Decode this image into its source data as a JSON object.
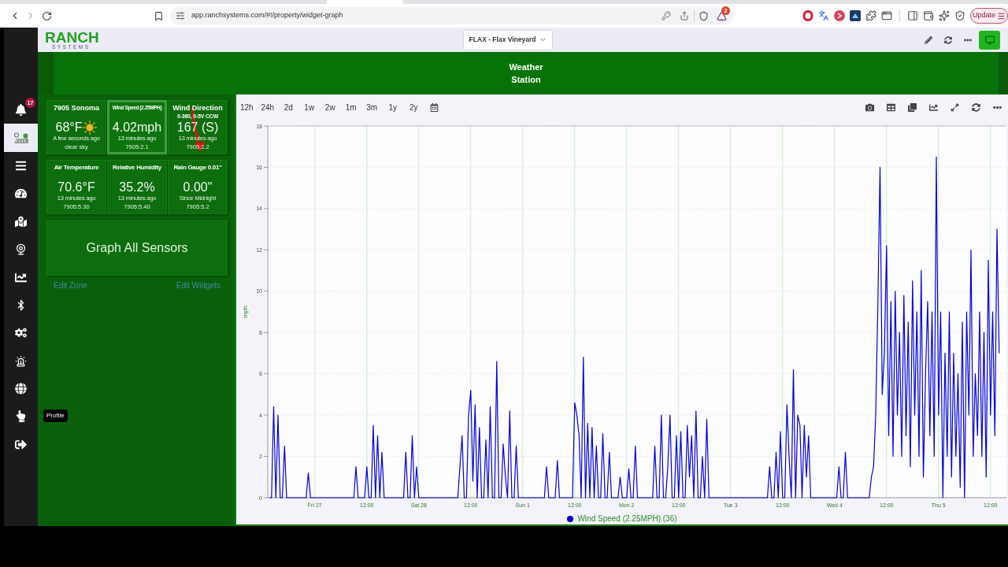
{
  "browser": {
    "forward_disabled": true,
    "url": "app.ranchsystems.com/#!/property/widget-graph",
    "rewards_badge": "2",
    "update_button": "Update"
  },
  "header": {
    "logo": "RANCH",
    "logo_tagline": "SYSTEMS",
    "property_selector": "FLAX - Flax Vineyard"
  },
  "banner": {
    "title": "Weather Station"
  },
  "sidebar": {
    "items": [
      {
        "selected": false,
        "badge": "17"
      },
      {
        "selected": true
      },
      {
        "selected": false
      },
      {
        "selected": false
      },
      {
        "selected": false
      },
      {
        "selected": false
      },
      {
        "selected": false
      },
      {
        "selected": false
      },
      {
        "selected": false
      },
      {
        "selected": false
      },
      {
        "selected": false
      },
      {
        "selected": false,
        "tooltip": "Profile"
      },
      {
        "selected": false
      }
    ]
  },
  "widgets": [
    {
      "kind": "weather",
      "title": "7905 Sonoma",
      "value": "68°F",
      "time": "A few seconds ago",
      "detail": "clear sky",
      "selected": false
    },
    {
      "kind": "compact",
      "title": "Wind Speed (2.25MPH)",
      "value": "4.02mph",
      "time": "13 minutes ago",
      "detail": "7905:2.1",
      "selected": true
    },
    {
      "kind": "direction",
      "title": "Wind Direction",
      "subtitle": "0-360, 0-5V CCW",
      "value": "167 (S)",
      "time": "13 minutes ago",
      "detail": "7905:2.2",
      "selected": false
    },
    {
      "kind": "sensor",
      "title": "Air Temperature",
      "value": "70.6°F",
      "time": "13 minutes ago",
      "detail": "7905:5.30",
      "selected": false
    },
    {
      "kind": "sensor",
      "title": "Relative Humidity",
      "value": "35.2%",
      "time": "13 minutes ago",
      "detail": "7905:5.40",
      "selected": false
    },
    {
      "kind": "sensor",
      "title": "Rain Gauge 0.01\"",
      "value": "0.00\"",
      "time": "Since Midnight",
      "detail": "7905:5.2",
      "selected": false
    }
  ],
  "graph_all_button": "Graph All Sensors",
  "links": {
    "edit_zone": "Edit Zone",
    "edit_widgets": "Edit Widgets"
  },
  "chart_panel": {
    "ranges": [
      "12h",
      "24h",
      "2d",
      "1w",
      "2w",
      "1m",
      "3m",
      "1y",
      "2y"
    ],
    "chart_data": {
      "type": "line",
      "grid": true,
      "ylabel": "mph",
      "ylim": [
        0,
        18
      ],
      "yticks": [
        0,
        2,
        4,
        6,
        8,
        10,
        12,
        14,
        16,
        18
      ],
      "categories": [
        null,
        null,
        null,
        null,
        null,
        null,
        null,
        null,
        null,
        null,
        null,
        null,
        null,
        null,
        null,
        null,
        null,
        null,
        null,
        null,
        null,
        "Fri 27",
        null,
        null,
        null,
        null,
        null,
        null,
        null,
        null,
        null,
        null,
        null,
        null,
        null,
        null,
        null,
        null,
        null,
        null,
        null,
        null,
        null,
        null,
        null,
        "12:00",
        null,
        null,
        null,
        null,
        null,
        null,
        null,
        null,
        null,
        null,
        null,
        null,
        null,
        null,
        null,
        null,
        null,
        null,
        null,
        null,
        null,
        null,
        null,
        "Sat 28",
        null,
        null,
        null,
        null,
        null,
        null,
        null,
        null,
        null,
        null,
        null,
        null,
        null,
        null,
        null,
        null,
        null,
        null,
        null,
        null,
        null,
        null,
        null,
        "12:00",
        null,
        null,
        null,
        null,
        null,
        null,
        null,
        null,
        null,
        null,
        null,
        null,
        null,
        null,
        null,
        null,
        null,
        null,
        null,
        null,
        null,
        null,
        null,
        "Sun 1",
        null,
        null,
        null,
        null,
        null,
        null,
        null,
        null,
        null,
        null,
        null,
        null,
        null,
        null,
        null,
        null,
        null,
        null,
        null,
        null,
        null,
        null,
        null,
        "12:00",
        null,
        null,
        null,
        null,
        null,
        null,
        null,
        null,
        null,
        null,
        null,
        null,
        null,
        null,
        null,
        null,
        null,
        null,
        null,
        null,
        null,
        null,
        null,
        "Mon 2",
        null,
        null,
        null,
        null,
        null,
        null,
        null,
        null,
        null,
        null,
        null,
        null,
        null,
        null,
        null,
        null,
        null,
        null,
        null,
        null,
        null,
        null,
        null,
        "12:00",
        null,
        null,
        null,
        null,
        null,
        null,
        null,
        null,
        null,
        null,
        null,
        null,
        null,
        null,
        null,
        null,
        null,
        null,
        null,
        null,
        null,
        null,
        null,
        "Tue 3",
        null,
        null,
        null,
        null,
        null,
        null,
        null,
        null,
        null,
        null,
        null,
        null,
        null,
        null,
        null,
        null,
        null,
        null,
        null,
        null,
        null,
        null,
        null,
        "12:00",
        null,
        null,
        null,
        null,
        null,
        null,
        null,
        null,
        null,
        null,
        null,
        null,
        null,
        null,
        null,
        null,
        null,
        null,
        null,
        null,
        null,
        null,
        null,
        "Wed 4",
        null,
        null,
        null,
        null,
        null,
        null,
        null,
        null,
        null,
        null,
        null,
        null,
        null,
        null,
        null,
        null,
        null,
        null,
        null,
        null,
        null,
        null,
        null,
        "12:00",
        null,
        null,
        null,
        null,
        null,
        null,
        null,
        null,
        null,
        null,
        null,
        null,
        null,
        null,
        null,
        null,
        null,
        null,
        null,
        null,
        null,
        null,
        null,
        "Thu 5",
        null,
        null,
        null,
        null,
        null,
        null,
        null,
        null,
        null,
        null,
        null,
        null,
        null,
        null,
        null,
        null,
        null,
        null,
        null,
        null,
        null,
        null,
        null,
        "12:00",
        null,
        null,
        null,
        null,
        null,
        null,
        null
      ],
      "series": [
        {
          "name": "Wind Speed (2.25MPH) (36)",
          "color": "#0000dd",
          "values": [
            0,
            0,
            4.4,
            0,
            4.0,
            0,
            0,
            2.5,
            0,
            0,
            0,
            0,
            0,
            0,
            0,
            0,
            0,
            0,
            1.2,
            0,
            0,
            0,
            0,
            0,
            0,
            0,
            0,
            0,
            0,
            0,
            0,
            0,
            0,
            0,
            0,
            0,
            0,
            0,
            0,
            0,
            1.5,
            0,
            0,
            0,
            0,
            1.5,
            0,
            0,
            3.5,
            0,
            3.0,
            0,
            2.2,
            0,
            0,
            0,
            0,
            0,
            0,
            0,
            0,
            0,
            0,
            2.2,
            0,
            0,
            3.0,
            0,
            1.5,
            0,
            0,
            0,
            0,
            0,
            0,
            0,
            0,
            0,
            0,
            0,
            0,
            0,
            0,
            0,
            0,
            0,
            0,
            0,
            1.5,
            3.0,
            0,
            0,
            4.0,
            5.2,
            0.8,
            4.5,
            0,
            3.4,
            0,
            0,
            2.8,
            0,
            4.4,
            0,
            0,
            6.6,
            0,
            0,
            2.6,
            1,
            0,
            4.2,
            0,
            0,
            2.5,
            0,
            0,
            0,
            0,
            0,
            0,
            0,
            0,
            0,
            0,
            0,
            0,
            0,
            1.5,
            0,
            0,
            0,
            0,
            1.8,
            0,
            0,
            0,
            0,
            0,
            0,
            0,
            4.6,
            4.0,
            3.0,
            0,
            6.8,
            0,
            3.6,
            0,
            3.4,
            0,
            2.5,
            0,
            0,
            3.1,
            0,
            0,
            2.2,
            0,
            0,
            0,
            0,
            1.0,
            0,
            0,
            0,
            1.4,
            0,
            0,
            2.5,
            0,
            0,
            0,
            0,
            0,
            0,
            0,
            0,
            2.5,
            0,
            0,
            4.0,
            0,
            0,
            1.5,
            4.0,
            0,
            0,
            3.0,
            0,
            3.2,
            0,
            0,
            3.5,
            1.0,
            3.0,
            0,
            4.2,
            0,
            0,
            2.0,
            0,
            3.8,
            0,
            0,
            0,
            0,
            0,
            0,
            0,
            0,
            0,
            0,
            0,
            0,
            0,
            0,
            0,
            0,
            0,
            0,
            0,
            0,
            0,
            0,
            0,
            0,
            0,
            0,
            0,
            0,
            1.5,
            0,
            0,
            2.2,
            0,
            3.2,
            0,
            0,
            4.5,
            2.0,
            0,
            6.2,
            0,
            4.0,
            3.5,
            0,
            3.5,
            1.0,
            3.0,
            0,
            0,
            0,
            0,
            0,
            0,
            0,
            0,
            0,
            0,
            0,
            0,
            0,
            1.5,
            0,
            0,
            2.2,
            0,
            0,
            0,
            0,
            0,
            0,
            0,
            0,
            0,
            0,
            0,
            1.0,
            1.5,
            4,
            9.5,
            16.0,
            5,
            7,
            12.2,
            3,
            9.5,
            2,
            10,
            4,
            8,
            2,
            9.8,
            3,
            8.5,
            1.5,
            10.5,
            4,
            9,
            2,
            11,
            1,
            6,
            9.5,
            3,
            9,
            2,
            16.5,
            4,
            9,
            0,
            7,
            2,
            9,
            1,
            7,
            2,
            6,
            0.5,
            8.5,
            0,
            9,
            4,
            12,
            2,
            6,
            3,
            9,
            2,
            8,
            1,
            11.5,
            4,
            9,
            3,
            13,
            7,
            null,
            null,
            null
          ]
        }
      ]
    }
  }
}
